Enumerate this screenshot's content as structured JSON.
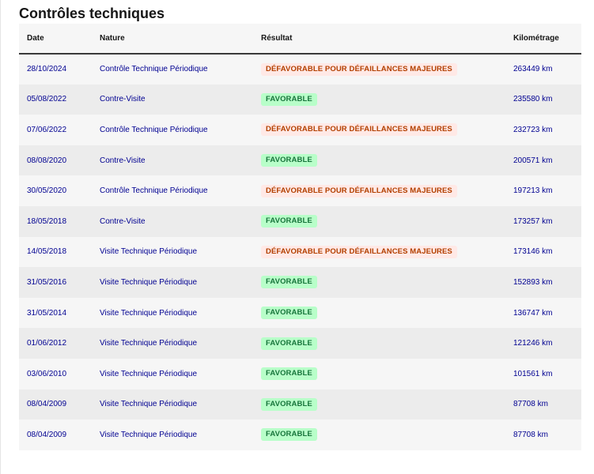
{
  "section": {
    "title": "Contrôles techniques"
  },
  "columns": [
    "Date",
    "Nature",
    "Résultat",
    "Kilométrage"
  ],
  "colors": {
    "favorable_bg": "#b8fec9",
    "favorable_text": "#18753c",
    "defavorable_bg": "#ffe9e6",
    "defavorable_text": "#b34000",
    "link_blue": "#000091"
  },
  "rows": [
    {
      "date": "28/10/2024",
      "nature": "Contrôle Technique Périodique",
      "result": "DÉFAVORABLE POUR DÉFAILLANCES MAJEURES",
      "status": "ko",
      "km": "263449 km"
    },
    {
      "date": "05/08/2022",
      "nature": "Contre-Visite",
      "result": "FAVORABLE",
      "status": "ok",
      "km": "235580 km"
    },
    {
      "date": "07/06/2022",
      "nature": "Contrôle Technique Périodique",
      "result": "DÉFAVORABLE POUR DÉFAILLANCES MAJEURES",
      "status": "ko",
      "km": "232723 km"
    },
    {
      "date": "08/08/2020",
      "nature": "Contre-Visite",
      "result": "FAVORABLE",
      "status": "ok",
      "km": "200571 km"
    },
    {
      "date": "30/05/2020",
      "nature": "Contrôle Technique Périodique",
      "result": "DÉFAVORABLE POUR DÉFAILLANCES MAJEURES",
      "status": "ko",
      "km": "197213 km"
    },
    {
      "date": "18/05/2018",
      "nature": "Contre-Visite",
      "result": "FAVORABLE",
      "status": "ok",
      "km": "173257 km"
    },
    {
      "date": "14/05/2018",
      "nature": "Visite Technique Périodique",
      "result": "DÉFAVORABLE POUR DÉFAILLANCES MAJEURES",
      "status": "ko",
      "km": "173146 km"
    },
    {
      "date": "31/05/2016",
      "nature": "Visite Technique Périodique",
      "result": "FAVORABLE",
      "status": "ok",
      "km": "152893 km"
    },
    {
      "date": "31/05/2014",
      "nature": "Visite Technique Périodique",
      "result": "FAVORABLE",
      "status": "ok",
      "km": "136747 km"
    },
    {
      "date": "01/06/2012",
      "nature": "Visite Technique Périodique",
      "result": "FAVORABLE",
      "status": "ok",
      "km": "121246 km"
    },
    {
      "date": "03/06/2010",
      "nature": "Visite Technique Périodique",
      "result": "FAVORABLE",
      "status": "ok",
      "km": "101561 km"
    },
    {
      "date": "08/04/2009",
      "nature": "Visite Technique Périodique",
      "result": "FAVORABLE",
      "status": "ok",
      "km": "87708 km"
    },
    {
      "date": "08/04/2009",
      "nature": "Visite Technique Périodique",
      "result": "FAVORABLE",
      "status": "ok",
      "km": "87708 km"
    }
  ]
}
